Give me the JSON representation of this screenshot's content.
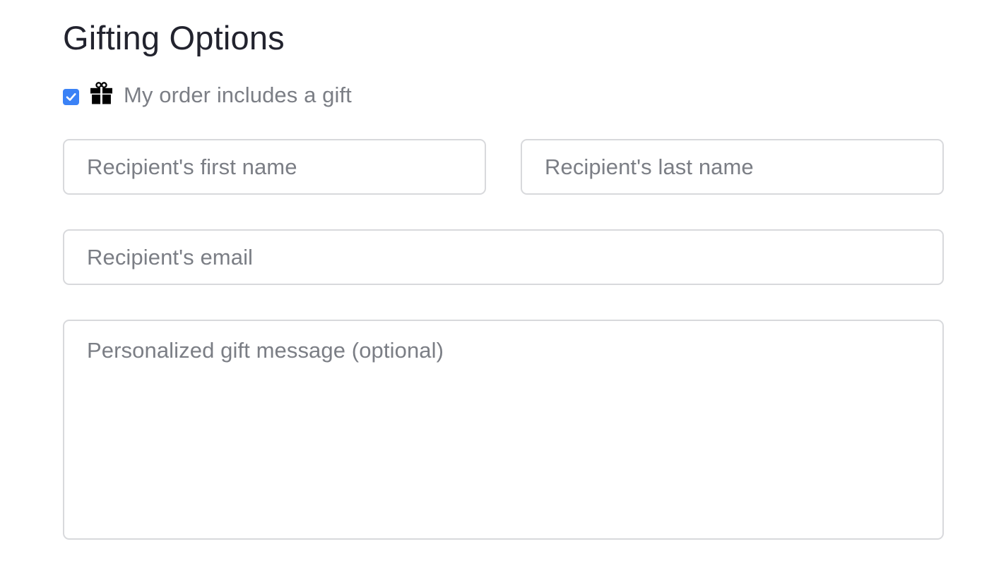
{
  "gifting": {
    "title": "Gifting Options",
    "checkbox": {
      "label": "My order includes a gift",
      "checked": true,
      "icon": "gift-icon",
      "accent_color": "#3b82f6"
    },
    "fields": {
      "first_name": {
        "placeholder": "Recipient's first name",
        "value": ""
      },
      "last_name": {
        "placeholder": "Recipient's last name",
        "value": ""
      },
      "email": {
        "placeholder": "Recipient's email",
        "value": ""
      },
      "message": {
        "placeholder": "Personalized gift message (optional)",
        "value": ""
      }
    }
  }
}
